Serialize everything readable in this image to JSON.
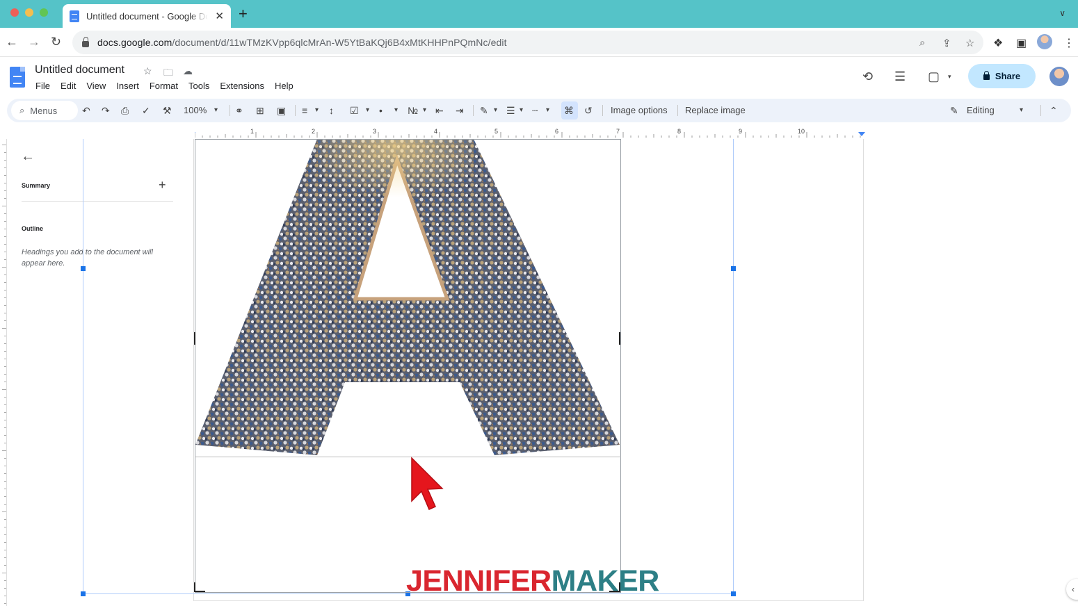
{
  "browser": {
    "tab_title": "Untitled document - Google Docs",
    "tab_close": "✕",
    "new_tab": "+",
    "url_host": "docs.google.com",
    "url_path": "/document/d/11wTMzKVpp6qlcMrAn-W5YtBaKQj6B4xMtKHHPnPQmNc/edit"
  },
  "docs": {
    "title": "Untitled document",
    "menu": [
      "File",
      "Edit",
      "View",
      "Insert",
      "Format",
      "Tools",
      "Extensions",
      "Help"
    ],
    "share_label": "Share"
  },
  "toolbar": {
    "search_label": "Menus",
    "zoom": "100%",
    "image_options": "Image options",
    "replace_image": "Replace image",
    "mode": "Editing"
  },
  "ruler": {
    "numbers": [
      "1",
      "2",
      "3",
      "4",
      "5",
      "6",
      "7",
      "8",
      "9",
      "10"
    ]
  },
  "sidebar": {
    "summary_label": "Summary",
    "outline_label": "Outline",
    "outline_hint": "Headings you add to the document will appear here."
  },
  "document": {
    "image_letter": "A"
  },
  "watermark": {
    "part1": "JENNIFER",
    "part2": "MAKER"
  },
  "colors": {
    "tab_strip": "#55c3c8",
    "share_bg": "#c2e7ff",
    "selection_blue": "#1a73e8",
    "watermark_red": "#d9262f",
    "watermark_teal": "#2d7f86"
  }
}
